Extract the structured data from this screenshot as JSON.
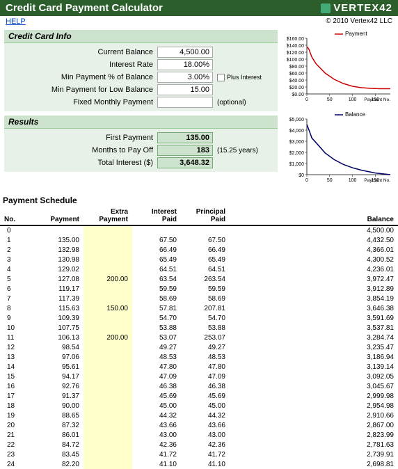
{
  "title": "Credit Card Payment Calculator",
  "logo": "VERTEX42",
  "help": "HELP",
  "copyright": "© 2010 Vertex42 LLC",
  "info_header": "Credit Card Info",
  "inputs": {
    "balance_label": "Current Balance",
    "balance": "4,500.00",
    "rate_label": "Interest Rate",
    "rate": "18.00%",
    "minpct_label": "Min Payment % of Balance",
    "minpct": "3.00%",
    "plus_interest": "Plus Interest",
    "minlow_label": "Min Payment for Low Balance",
    "minlow": "15.00",
    "fixed_label": "Fixed Monthly Payment",
    "fixed": "",
    "optional": "(optional)"
  },
  "results_header": "Results",
  "results": {
    "first_label": "First Payment",
    "first": "135.00",
    "months_label": "Months to Pay Off",
    "months": "183",
    "years": "(15.25 years)",
    "interest_label": "Total Interest ($)",
    "interest": "3,648.32"
  },
  "schedule_title": "Payment Schedule",
  "cols": {
    "no": "No.",
    "payment": "Payment",
    "extra": "Extra\nPayment",
    "intpaid": "Interest\nPaid",
    "prinpaid": "Principal\nPaid",
    "balance": "Balance"
  },
  "rows": [
    {
      "no": "0",
      "payment": "",
      "extra": "",
      "int": "",
      "prin": "",
      "bal": "4,500.00"
    },
    {
      "no": "1",
      "payment": "135.00",
      "extra": "",
      "int": "67.50",
      "prin": "67.50",
      "bal": "4,432.50"
    },
    {
      "no": "2",
      "payment": "132.98",
      "extra": "",
      "int": "66.49",
      "prin": "66.49",
      "bal": "4,366.01"
    },
    {
      "no": "3",
      "payment": "130.98",
      "extra": "",
      "int": "65.49",
      "prin": "65.49",
      "bal": "4,300.52"
    },
    {
      "no": "4",
      "payment": "129.02",
      "extra": "",
      "int": "64.51",
      "prin": "64.51",
      "bal": "4,236.01"
    },
    {
      "no": "5",
      "payment": "127.08",
      "extra": "200.00",
      "int": "63.54",
      "prin": "263.54",
      "bal": "3,972.47"
    },
    {
      "no": "6",
      "payment": "119.17",
      "extra": "",
      "int": "59.59",
      "prin": "59.59",
      "bal": "3,912.89"
    },
    {
      "no": "7",
      "payment": "117.39",
      "extra": "",
      "int": "58.69",
      "prin": "58.69",
      "bal": "3,854.19"
    },
    {
      "no": "8",
      "payment": "115.63",
      "extra": "150.00",
      "int": "57.81",
      "prin": "207.81",
      "bal": "3,646.38"
    },
    {
      "no": "9",
      "payment": "109.39",
      "extra": "",
      "int": "54.70",
      "prin": "54.70",
      "bal": "3,591.69"
    },
    {
      "no": "10",
      "payment": "107.75",
      "extra": "",
      "int": "53.88",
      "prin": "53.88",
      "bal": "3,537.81"
    },
    {
      "no": "11",
      "payment": "106.13",
      "extra": "200.00",
      "int": "53.07",
      "prin": "253.07",
      "bal": "3,284.74"
    },
    {
      "no": "12",
      "payment": "98.54",
      "extra": "",
      "int": "49.27",
      "prin": "49.27",
      "bal": "3,235.47"
    },
    {
      "no": "13",
      "payment": "97.06",
      "extra": "",
      "int": "48.53",
      "prin": "48.53",
      "bal": "3,186.94"
    },
    {
      "no": "14",
      "payment": "95.61",
      "extra": "",
      "int": "47.80",
      "prin": "47.80",
      "bal": "3,139.14"
    },
    {
      "no": "15",
      "payment": "94.17",
      "extra": "",
      "int": "47.09",
      "prin": "47.09",
      "bal": "3,092.05"
    },
    {
      "no": "16",
      "payment": "92.76",
      "extra": "",
      "int": "46.38",
      "prin": "46.38",
      "bal": "3,045.67"
    },
    {
      "no": "17",
      "payment": "91.37",
      "extra": "",
      "int": "45.69",
      "prin": "45.69",
      "bal": "2,999.98"
    },
    {
      "no": "18",
      "payment": "90.00",
      "extra": "",
      "int": "45.00",
      "prin": "45.00",
      "bal": "2,954.98"
    },
    {
      "no": "19",
      "payment": "88.65",
      "extra": "",
      "int": "44.32",
      "prin": "44.32",
      "bal": "2,910.66"
    },
    {
      "no": "20",
      "payment": "87.32",
      "extra": "",
      "int": "43.66",
      "prin": "43.66",
      "bal": "2,867.00"
    },
    {
      "no": "21",
      "payment": "86.01",
      "extra": "",
      "int": "43.00",
      "prin": "43.00",
      "bal": "2,823.99"
    },
    {
      "no": "22",
      "payment": "84.72",
      "extra": "",
      "int": "42.36",
      "prin": "42.36",
      "bal": "2,781.63"
    },
    {
      "no": "23",
      "payment": "83.45",
      "extra": "",
      "int": "41.72",
      "prin": "41.72",
      "bal": "2,739.91"
    },
    {
      "no": "24",
      "payment": "82.20",
      "extra": "",
      "int": "41.10",
      "prin": "41.10",
      "bal": "2,698.81"
    }
  ],
  "chart_data": [
    {
      "type": "line",
      "title": "",
      "legend": "Payment",
      "color": "#cc0000",
      "xlabel": "Payment No.",
      "ylabel": "",
      "xlim": [
        0,
        183
      ],
      "ylim": [
        0,
        160
      ],
      "yticks": [
        "$0.00",
        "$20.00",
        "$40.00",
        "$60.00",
        "$80.00",
        "$100.00",
        "$120.00",
        "$140.00",
        "$160.00"
      ],
      "xticks": [
        "0",
        "50",
        "100",
        "150"
      ],
      "series": [
        {
          "name": "Payment",
          "x": [
            1,
            5,
            8,
            11,
            20,
            40,
            60,
            80,
            100,
            120,
            140,
            160,
            183
          ],
          "y": [
            135,
            127,
            116,
            106,
            87,
            60,
            42,
            30,
            22,
            18,
            16,
            15,
            15
          ]
        }
      ]
    },
    {
      "type": "line",
      "title": "",
      "legend": "Balance",
      "color": "#000066",
      "xlabel": "Payment No.",
      "ylabel": "",
      "xlim": [
        0,
        183
      ],
      "ylim": [
        0,
        5000
      ],
      "yticks": [
        "$0",
        "$1,000",
        "$2,000",
        "$3,000",
        "$4,000",
        "$5,000"
      ],
      "xticks": [
        "0",
        "50",
        "100",
        "150"
      ],
      "series": [
        {
          "name": "Balance",
          "x": [
            0,
            5,
            11,
            24,
            40,
            60,
            80,
            100,
            120,
            150,
            183
          ],
          "y": [
            4500,
            3972,
            3285,
            2699,
            1950,
            1350,
            920,
            620,
            400,
            150,
            0
          ]
        }
      ]
    }
  ]
}
